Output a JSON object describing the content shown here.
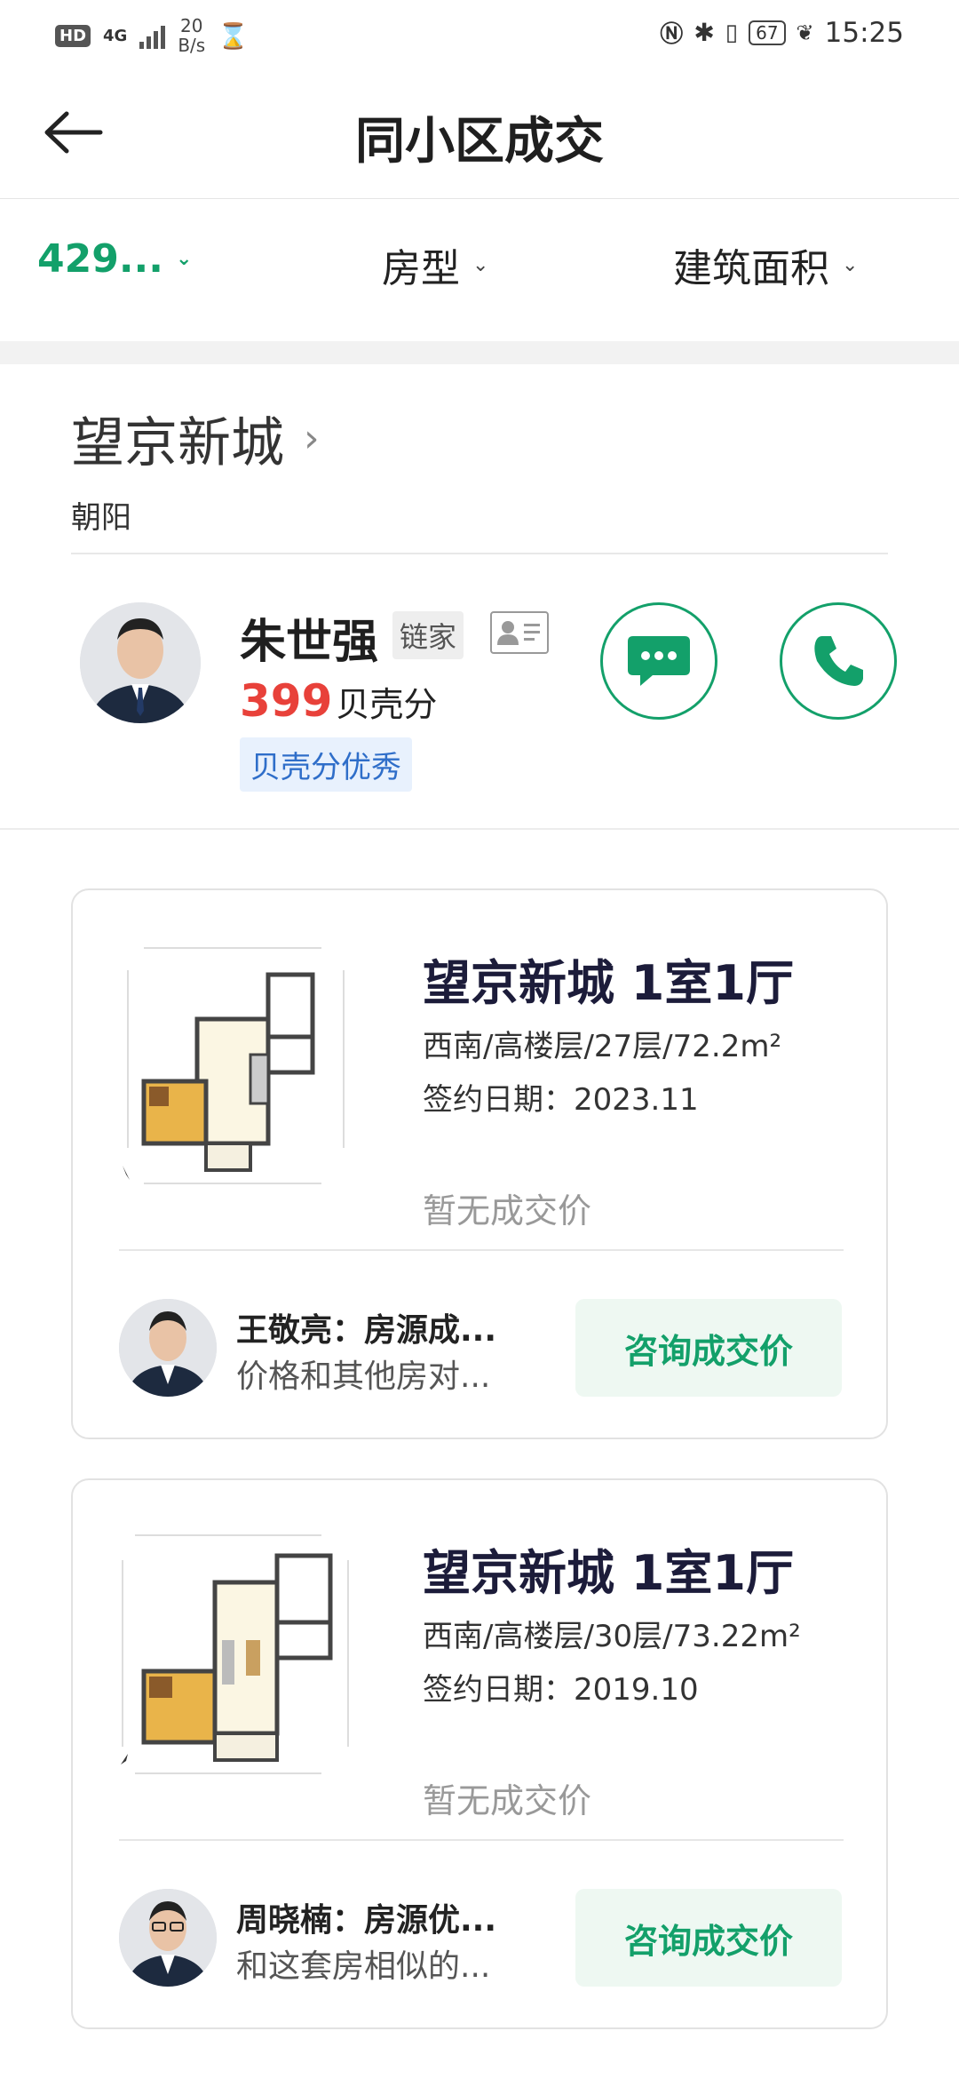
{
  "status_bar": {
    "hd": "HD",
    "network": "4G",
    "speed_value": "20",
    "speed_unit": "B/s",
    "battery": "67",
    "time": "15:25"
  },
  "header": {
    "title": "同小区成交"
  },
  "filters": {
    "price": "429...",
    "room_type": "房型",
    "area": "建筑面积"
  },
  "community": {
    "name": "望京新城",
    "district": "朝阳"
  },
  "agent": {
    "name": "朱世强",
    "brand": "链家",
    "score": "399",
    "score_label": "贝壳分",
    "score_badge": "贝壳分优秀"
  },
  "listings": [
    {
      "title": "望京新城 1室1厅",
      "meta": "西南/高楼层/27层/72.2m²",
      "date": "签约日期：2023.11",
      "price": "暂无成交价",
      "comment_title": "王敬亮：房源成...",
      "comment_sub": "价格和其他房对...",
      "button": "咨询成交价"
    },
    {
      "title": "望京新城 1室1厅",
      "meta": "西南/高楼层/30层/73.22m²",
      "date": "签约日期：2019.10",
      "price": "暂无成交价",
      "comment_title": "周晓楠：房源优...",
      "comment_sub": "和这套房相似的...",
      "button": "咨询成交价"
    }
  ],
  "colors": {
    "accent": "#13a06a",
    "score": "#e8413a",
    "badge_text": "#2f6ec9",
    "badge_bg": "#e8f1fd"
  }
}
